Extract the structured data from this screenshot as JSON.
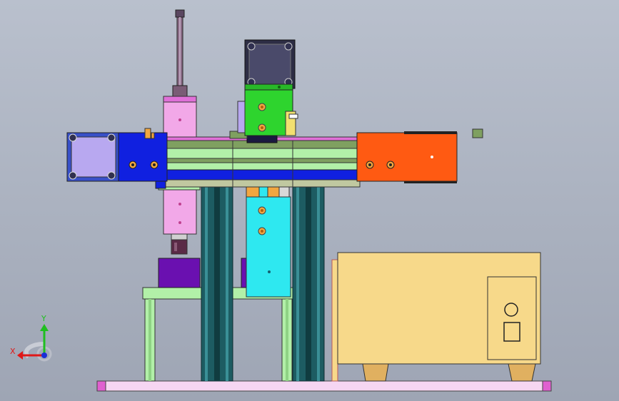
{
  "triad": {
    "y_label": "Y",
    "x_label": "X",
    "y_color": "#1fbf1f",
    "x_color": "#e01818",
    "z_color": "#1a2fd6"
  },
  "colors": {
    "motor_face_dark": "#4a4a6a",
    "motor_face_light": "#b8a8f0",
    "green_bracket": "#2ed42e",
    "blue_block": "#1020e0",
    "orange_block": "#ff5a12",
    "pink_block": "#f2a8e8",
    "cyan_block": "#2ee8f0",
    "purple_block": "#6a10b0",
    "teal_column": "#1d5c62",
    "cabinet": "#f7d98a",
    "base_plate": "#f6d6f2",
    "copper": "#f2a640",
    "light_green": "#b2f0a8",
    "olive": "#7fa060"
  }
}
